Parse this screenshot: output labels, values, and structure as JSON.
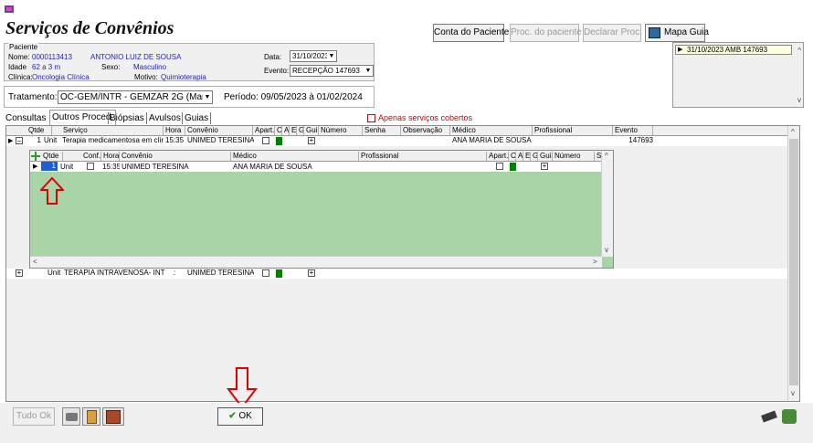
{
  "header": {
    "title": "Serviços de Convênios",
    "buttons": {
      "conta_paciente": "Conta do Paciente",
      "proc_paciente": "Proc. do paciente",
      "declarar_proc": "Declarar Proc.",
      "mapa_guia": "Mapa Guia"
    }
  },
  "patient": {
    "legend": "Paciente",
    "nome_label": "Nome:",
    "nome_codigo": "0000113413",
    "nome_valor": "ANTONIO LUIZ DE SOUSA",
    "idade_label": "Idade",
    "idade_valor": "62 a 3 m",
    "sexo_label": "Sexo:",
    "sexo_valor": "Masculino",
    "clinica_label": "Clínica:",
    "clinica_valor": "Oncologia Clínica",
    "motivo_label": "Motivo:",
    "motivo_valor": "Quimioterapia",
    "data_label": "Data:",
    "data_valor": "31/10/2023",
    "evento_label": "Evento:",
    "evento_valor": "RECEPÇÃO 147693"
  },
  "side_list": {
    "item": "31/10/2023  AMB 147693"
  },
  "treatment": {
    "label": "Tratamento:",
    "value": "OC-GEM/INTR - GEMZAR 2G (Manutençã",
    "period": "Período: 09/05/2023 à 01/02/2024"
  },
  "tabs": [
    "Consultas",
    "Outros Proced.",
    "Biópsias",
    "Avulsos",
    "Guias"
  ],
  "only_covered": "Apenas serviços cobertos",
  "outer_grid": {
    "headers": [
      "Qtde",
      "Serviço",
      "Hora",
      "Convênio",
      "Apart.",
      "C",
      "A",
      "E",
      "G",
      "Guia",
      "Número",
      "Senha",
      "Observação",
      "Médico",
      "Profissional",
      "Evento"
    ],
    "row1": {
      "qtde": "1",
      "unit": "Unit",
      "servico": "Terapia medicamentosa em clínica",
      "hora": "15:35",
      "convenio": "UNIMED TERESINA",
      "medico": "ANA MARIA DE SOUSA",
      "evento": "147693"
    },
    "row2": {
      "unit": "Unit",
      "servico": "TERAPIA INTRAVENOSA- INTRODI",
      "hora": ":",
      "convenio": "UNIMED TERESINA"
    }
  },
  "inner_grid": {
    "headers": [
      "Qtde",
      "Conf.",
      "Hora",
      "Convênio",
      "Médico",
      "Profissional",
      "Apart.",
      "C",
      "A",
      "E",
      "G",
      "Guia",
      "Número",
      "Ser"
    ],
    "row1": {
      "qtde": "1",
      "unit": "Unit",
      "hora": "15:35",
      "convenio": "UNIMED TERESINA",
      "medico": "ANA MARIA DE SOUSA"
    }
  },
  "bottom": {
    "tudo_ok": "Tudo Ok",
    "ok": "OK"
  },
  "colors": {
    "annotation_red": "#e00000",
    "green": "#008000",
    "inner_bg": "#a8d4a8",
    "selection_blue": "#1e5fd8"
  }
}
